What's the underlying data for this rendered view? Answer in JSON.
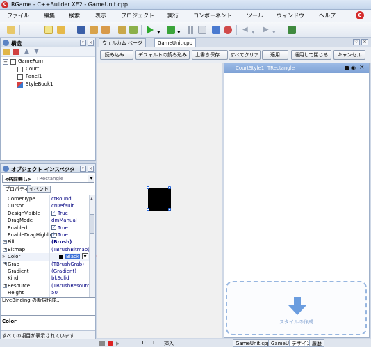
{
  "window": {
    "title": "RGame - C++Builder XE2 - GameUnit.cpp"
  },
  "menu": {
    "items": [
      "ファイル",
      "編集",
      "検索",
      "表示",
      "プロジェクト",
      "実行",
      "コンポーネント",
      "ツール",
      "ウィンドウ",
      "ヘルプ"
    ]
  },
  "structure": {
    "title": "構造",
    "tree": {
      "root": "GameForm",
      "children": [
        "Court",
        "Panel1",
        "StyleBook1"
      ]
    }
  },
  "inspector": {
    "title": "オブジェクト インスペクタ",
    "selector_name": "<名前無し>",
    "selector_type": "TRectangle",
    "tabs": [
      "プロパティ",
      "イベント"
    ],
    "rows": [
      {
        "name": "CornerType",
        "value": "ctRound"
      },
      {
        "name": "Cursor",
        "value": "crDefault"
      },
      {
        "name": "DesignVisible",
        "value": "True",
        "checkbox": true
      },
      {
        "name": "DragMode",
        "value": "dmManual"
      },
      {
        "name": "Enabled",
        "value": "True",
        "checkbox": true
      },
      {
        "name": "EnableDragHighlight",
        "value": "True",
        "checkbox": true
      },
      {
        "name": "Fill",
        "value": "(Brush)",
        "expander": "−"
      },
      {
        "name": "Bitmap",
        "value": "(TBrushBitmap)",
        "expander": "+"
      },
      {
        "name": "Color",
        "value": "Black",
        "selected": true
      },
      {
        "name": "Grab",
        "value": "(TBrushGrab)",
        "expander": "+"
      },
      {
        "name": "Gradient",
        "value": "(Gradient)"
      },
      {
        "name": "Kind",
        "value": "bkSolid"
      },
      {
        "name": "Resource",
        "value": "(TBrushResource",
        "expander": "+"
      },
      {
        "name": "Height",
        "value": "50"
      }
    ],
    "livebinding_text": "LiveBinding の新規作成...",
    "desc_label": "Color",
    "status_text": "すべての項目が表示されています"
  },
  "editor": {
    "tabs": [
      "ウェルカム ページ",
      "GameUnit.cpp"
    ],
    "buttons": {
      "load": "読み込み...",
      "load_default": "デフォルトの読み込み",
      "save": "上書き保存...",
      "clear_all": "すべてクリア",
      "apply": "適用",
      "apply_close": "適用して閉じる",
      "cancel": "キャンセル"
    },
    "style_panel_title": "CourtStyle1: TRectangle",
    "drop_label": "スタイルの作成"
  },
  "statusbar": {
    "position": "1:    1",
    "mode": "挿入",
    "bottom_tabs": [
      "GameUnit.cpp",
      "GameUnit1.h",
      "デザイン",
      "履歴"
    ]
  },
  "colors": {
    "accent": "#2a6ae0",
    "selected_value": "#3a6fd8",
    "style_header": "#8aabdd",
    "arrow": "#e02020"
  }
}
